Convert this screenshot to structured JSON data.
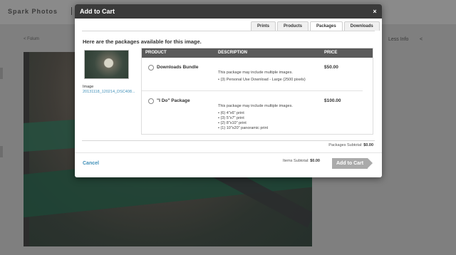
{
  "background": {
    "brand": "Spark Photos",
    "back_link": "< Folum",
    "less_info": "Less Info",
    "share_icon": "share-icon"
  },
  "modal": {
    "title": "Add to Cart",
    "close_label": "×",
    "tabs": [
      {
        "label": "Prints",
        "active": false
      },
      {
        "label": "Products",
        "active": false
      },
      {
        "label": "Packages",
        "active": true
      },
      {
        "label": "Downloads",
        "active": false
      }
    ],
    "intro": "Here are the packages available for this image.",
    "image_label": "Image",
    "image_filename": "20131118_120214_DSC408...",
    "columns": [
      "PRODUCT",
      "DESCRIPTION",
      "PRICE"
    ],
    "packages": [
      {
        "name": "Downloads Bundle",
        "description": "This package may include multiple images.",
        "items": [
          "(3) Personal Use Download - Large (2500 pixels)"
        ],
        "price": "$50.00"
      },
      {
        "name": "\"I Do\" Package",
        "description": "This package may include multiple images.",
        "items": [
          "(6) 4\"x6\" print",
          "(3) 5\"x7\" print",
          "(2) 8\"x10\" print",
          "(1) 10\"x20\" panoramic print"
        ],
        "price": "$100.00"
      }
    ],
    "packages_subtotal_label": "Packages Subtotal:",
    "packages_subtotal_value": "$0.00",
    "cancel_label": "Cancel",
    "items_subtotal_label": "Items Subtotal:",
    "items_subtotal_value": "$0.00",
    "add_to_cart_label": "Add to Cart"
  },
  "colors": {
    "titlebar": "#3a3a3a",
    "link": "#3f8fb8",
    "table_header": "#5a5a5a",
    "button_disabled": "#aaaaaa"
  }
}
